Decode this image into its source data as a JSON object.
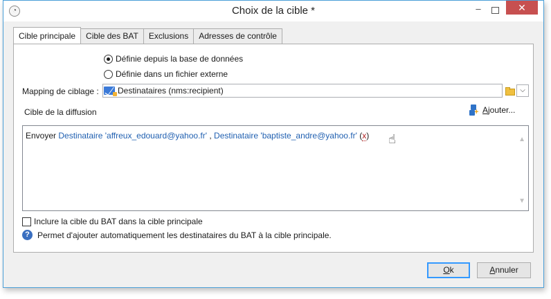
{
  "window": {
    "title": "Choix de la cible *",
    "controls": {
      "minimize": "–",
      "close": "✕"
    }
  },
  "tabs": [
    {
      "label": "Cible principale",
      "active": true
    },
    {
      "label": "Cible des BAT",
      "active": false
    },
    {
      "label": "Exclusions",
      "active": false
    },
    {
      "label": "Adresses de contrôle",
      "active": false
    }
  ],
  "source": {
    "options": [
      {
        "label": "Définie depuis la base de données",
        "selected": true
      },
      {
        "label": "Définie dans un fichier externe",
        "selected": false
      }
    ]
  },
  "mapping": {
    "label": "Mapping de ciblage :",
    "value": "Destinataires (nms:recipient)"
  },
  "target": {
    "section_title": "Cible de la diffusion",
    "add_label_underlined": "A",
    "add_label_rest": "jouter...",
    "prefix": "Envoyer ",
    "recipients": [
      "Destinataire 'affreux_edouard@yahoo.fr'",
      "Destinataire 'baptiste_andre@yahoo.fr'"
    ],
    "separator": " , ",
    "remove_open": " (",
    "remove_x": "x",
    "remove_close": ")"
  },
  "include_bat": {
    "label": "Inclure la cible du BAT dans la cible principale",
    "checked": false
  },
  "help": {
    "text": "Permet d'ajouter automatiquement les destinataires du BAT à la cible principale."
  },
  "buttons": {
    "ok_underlined": "O",
    "ok_rest": "k",
    "cancel_underlined": "A",
    "cancel_rest": "nnuler"
  },
  "colors": {
    "link": "#1f5fb0",
    "close_button": "#c75050",
    "window_border": "#4a9fd8"
  }
}
